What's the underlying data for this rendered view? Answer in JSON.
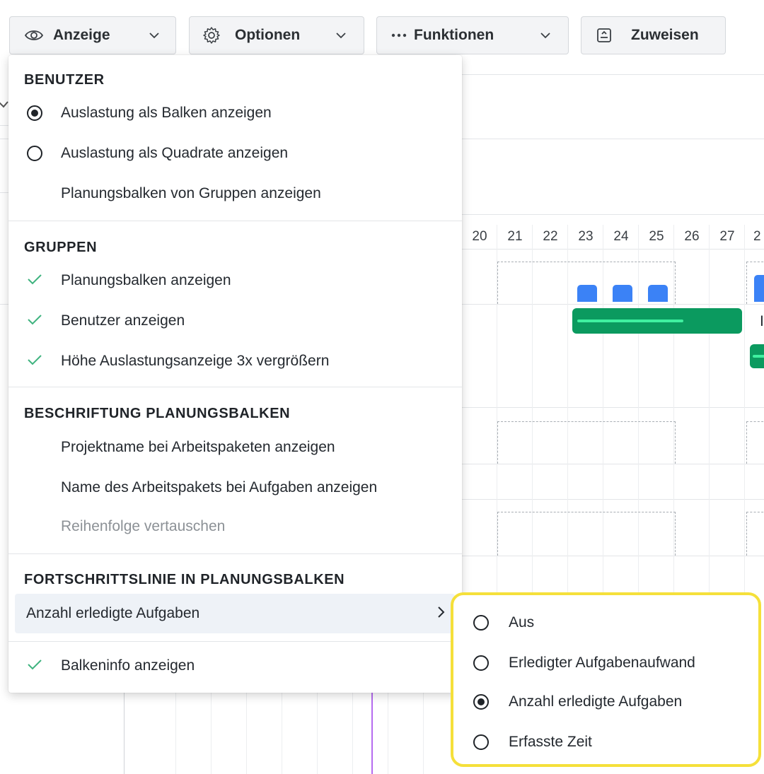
{
  "toolbar": {
    "display": {
      "label": "Anzeige",
      "icon": "eye-icon"
    },
    "options": {
      "label": "Optionen",
      "icon": "gear-icon"
    },
    "functions": {
      "label": "Funktionen",
      "icon": "more-dots-icon"
    },
    "assign": {
      "label": "Zuweisen",
      "icon": "assign-icon"
    }
  },
  "gantt": {
    "days": [
      "20",
      "21",
      "22",
      "23",
      "24",
      "25",
      "26",
      "27",
      "2"
    ],
    "bar_label_fragment": "I",
    "colors": {
      "bar": "#0b9a5f",
      "progress": "#3ff0a0",
      "load": "#3b82f6",
      "today_line": "#b56cf0"
    }
  },
  "menu": {
    "sections": {
      "users": {
        "title": "BENUTZER",
        "items": [
          {
            "label": "Auslastung als Balken anzeigen",
            "control": "radio",
            "selected": true
          },
          {
            "label": "Auslastung als Quadrate anzeigen",
            "control": "radio",
            "selected": false
          },
          {
            "label": "Planungsbalken von Gruppen anzeigen",
            "control": "none"
          }
        ]
      },
      "groups": {
        "title": "GRUPPEN",
        "items": [
          {
            "label": "Planungsbalken anzeigen",
            "checked": true
          },
          {
            "label": "Benutzer anzeigen",
            "checked": true
          },
          {
            "label": "Höhe Auslastungsanzeige 3x vergrößern",
            "checked": true
          }
        ]
      },
      "labels": {
        "title": "BESCHRIFTUNG PLANUNGSBALKEN",
        "items": [
          {
            "label": "Projektname bei Arbeitspaketen anzeigen",
            "checked": false
          },
          {
            "label": "Name des Arbeitspakets bei Aufgaben anzeigen",
            "checked": false
          },
          {
            "label": "Reihenfolge vertauschen",
            "disabled": true
          }
        ]
      },
      "progress": {
        "title": "FORTSCHRITTSLINIE IN PLANUNGSBALKEN",
        "selected_label": "Anzahl erledigte Aufgaben"
      }
    },
    "bar_info": {
      "label": "Balkeninfo anzeigen",
      "checked": true
    }
  },
  "submenu": {
    "options": [
      {
        "label": "Aus",
        "selected": false
      },
      {
        "label": "Erledigter Aufgabenaufwand",
        "selected": false
      },
      {
        "label": "Anzahl erledigte Aufgaben",
        "selected": true
      },
      {
        "label": "Erfasste Zeit",
        "selected": false
      }
    ],
    "highlight_color": "#f5e03a"
  }
}
